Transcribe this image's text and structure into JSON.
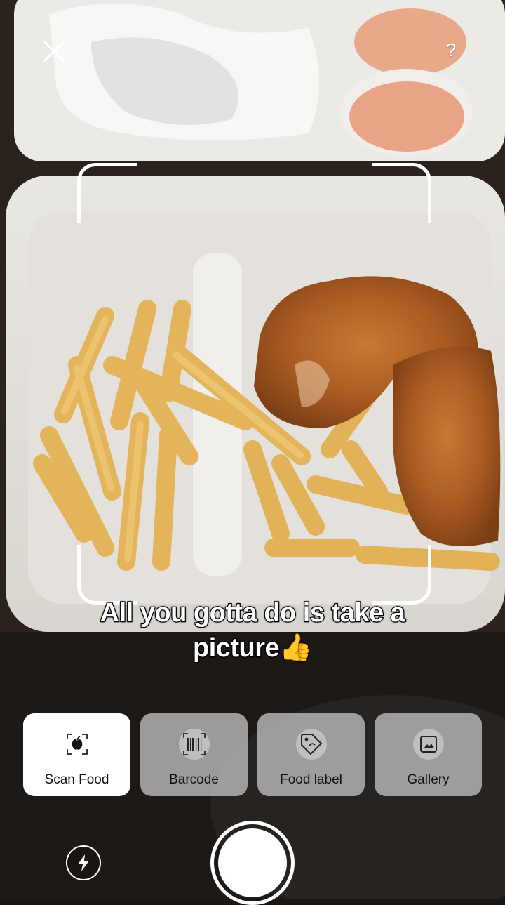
{
  "header": {
    "close_icon": "close-icon",
    "help_label": "?"
  },
  "caption": {
    "line1": "All you gotta do is take a",
    "line2": "picture",
    "emoji": "👍"
  },
  "modes": [
    {
      "label": "Scan Food",
      "icon": "scan-food-icon",
      "active": true
    },
    {
      "label": "Barcode",
      "icon": "barcode-icon",
      "active": false
    },
    {
      "label": "Food label",
      "icon": "food-label-icon",
      "active": false
    },
    {
      "label": "Gallery",
      "icon": "gallery-icon",
      "active": false
    }
  ],
  "controls": {
    "flash_icon": "flash-icon",
    "shutter": "shutter-button"
  },
  "colors": {
    "active_mode_bg": "#ffffff",
    "inactive_mode_bg": "#cdcdcd",
    "text": "#111111"
  }
}
